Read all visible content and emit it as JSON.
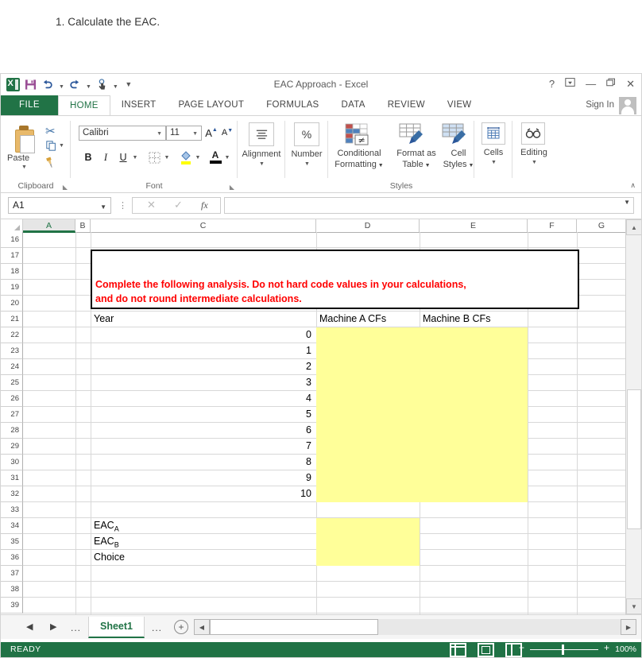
{
  "question": {
    "text": "1. Calculate the EAC."
  },
  "window": {
    "title": "EAC Approach - Excel",
    "quick_access": [
      {
        "name": "excel-logo",
        "label": "X"
      },
      {
        "name": "save",
        "label": "save-icon"
      },
      {
        "name": "undo",
        "label": "undo-icon"
      },
      {
        "name": "redo",
        "label": "redo-icon"
      },
      {
        "name": "touch-mode",
        "label": "touch-mode-icon"
      },
      {
        "name": "customize",
        "label": "customize-icon"
      }
    ],
    "buttons": {
      "help": "?",
      "ribbon_display": "⇱",
      "minimize": "—",
      "restore": "❐",
      "close": "✕"
    },
    "sign_in": "Sign In"
  },
  "ribbon": {
    "tabs": [
      {
        "label": "FILE",
        "active": false
      },
      {
        "label": "HOME",
        "active": true
      },
      {
        "label": "INSERT",
        "active": false
      },
      {
        "label": "PAGE LAYOUT",
        "active": false
      },
      {
        "label": "FORMULAS",
        "active": false
      },
      {
        "label": "DATA",
        "active": false
      },
      {
        "label": "REVIEW",
        "active": false
      },
      {
        "label": "VIEW",
        "active": false
      }
    ],
    "groups": {
      "clipboard": {
        "label": "Clipboard",
        "paste": "Paste",
        "cut": "cut-icon",
        "copy": "copy-icon",
        "format_painter": "format-painter-icon"
      },
      "font": {
        "label": "Font",
        "font_name": "Calibri",
        "font_size": "11",
        "grow_font": "A",
        "shrink_font": "A",
        "bold": "B",
        "italic": "I",
        "underline": "U",
        "borders": "borders-icon",
        "fill_color": "fill-color-icon",
        "font_color": "A"
      },
      "alignment": {
        "label": "Alignment"
      },
      "number": {
        "label": "Number",
        "symbol": "%"
      },
      "styles": {
        "label": "Styles",
        "conditional_formatting": "Conditional Formatting",
        "format_as_table": "Format as Table",
        "cell_styles": "Cell Styles"
      },
      "cells": {
        "label": "Cells"
      },
      "editing": {
        "label": "Editing"
      }
    }
  },
  "formula_bar": {
    "name_box": "A1",
    "cancel": "✕",
    "enter": "✓",
    "function": "fx",
    "formula": ""
  },
  "grid": {
    "columns": [
      "A",
      "B",
      "C",
      "D",
      "E",
      "F",
      "G"
    ],
    "selected_column": "A",
    "rows": [
      16,
      17,
      18,
      19,
      20,
      21,
      22,
      23,
      24,
      25,
      26,
      27,
      28,
      29,
      30,
      31,
      32,
      33,
      34,
      35,
      36,
      37,
      38,
      39
    ],
    "warning": {
      "line1": "Complete the following analysis. Do not hard code values in your calculations,",
      "line2": "and do not round intermediate calculations."
    },
    "headers": {
      "year": "Year",
      "machine_a": "Machine A CFs",
      "machine_b": "Machine B CFs"
    },
    "years": [
      "0",
      "1",
      "2",
      "3",
      "4",
      "5",
      "6",
      "7",
      "8",
      "9",
      "10"
    ],
    "labels": {
      "eac_a_base": "EAC",
      "eac_a_sub": "A",
      "eac_b_base": "EAC",
      "eac_b_sub": "B",
      "choice": "Choice"
    },
    "input_fill_color": "#ffff99"
  },
  "sheet_bar": {
    "prev": "◀",
    "next": "▶",
    "left_dots": "...",
    "right_dots": "...",
    "sheets": [
      "Sheet1"
    ],
    "active_sheet": "Sheet1",
    "add_sheet": "＋"
  },
  "status_bar": {
    "mode": "READY",
    "views": [
      "normal-view",
      "page-layout-view",
      "page-break-view"
    ],
    "zoom": "100%"
  }
}
